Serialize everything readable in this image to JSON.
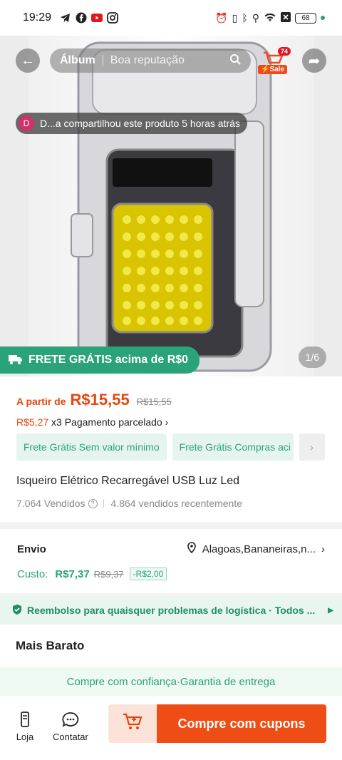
{
  "status_bar": {
    "time": "19:29",
    "battery": "68"
  },
  "hero": {
    "tabs": [
      "Álbum",
      "Boa reputação"
    ],
    "cart_count": "74",
    "sale_label": "Sale",
    "share_notice": "D...a compartilhou este produto 5 horas atrás",
    "share_avatar_letter": "D",
    "free_shipping_banner": "FRETE GRÁTIS acima de R$0",
    "pager": "1/6"
  },
  "product": {
    "price_prefix": "A partir de",
    "price": "R$15,55",
    "price_old": "R$15,55",
    "installment_value": "R$5,27",
    "installment_text": "x3 Pagamento parcelado",
    "chips": [
      "Frete Grátis Sem valor mínimo",
      "Frete Grátis Compras aci"
    ],
    "title": "Isqueiro Elétrico Recarregável USB Luz Led",
    "sold": "7.064 Vendidos",
    "sold_recent": "4.864 vendidos recentemente"
  },
  "shipping": {
    "label": "Envio",
    "location": "Alagoas,Bananeiras,n...",
    "cost_label": "Custo:",
    "cost": "R$7,37",
    "cost_old": "R$9,37",
    "discount": "-R$2,00"
  },
  "refund_text": "Reembolso para quaisquer problemas de logística · Todos ...",
  "section_cheapest": "Mais Barato",
  "guarantee_text": "Compre com confiança·Garantia de entrega",
  "bottom_nav": {
    "store": "Loja",
    "contact": "Contatar",
    "buy": "Compre com cupons"
  },
  "colors": {
    "accent": "#ee4d16",
    "green": "#2aa37b"
  }
}
